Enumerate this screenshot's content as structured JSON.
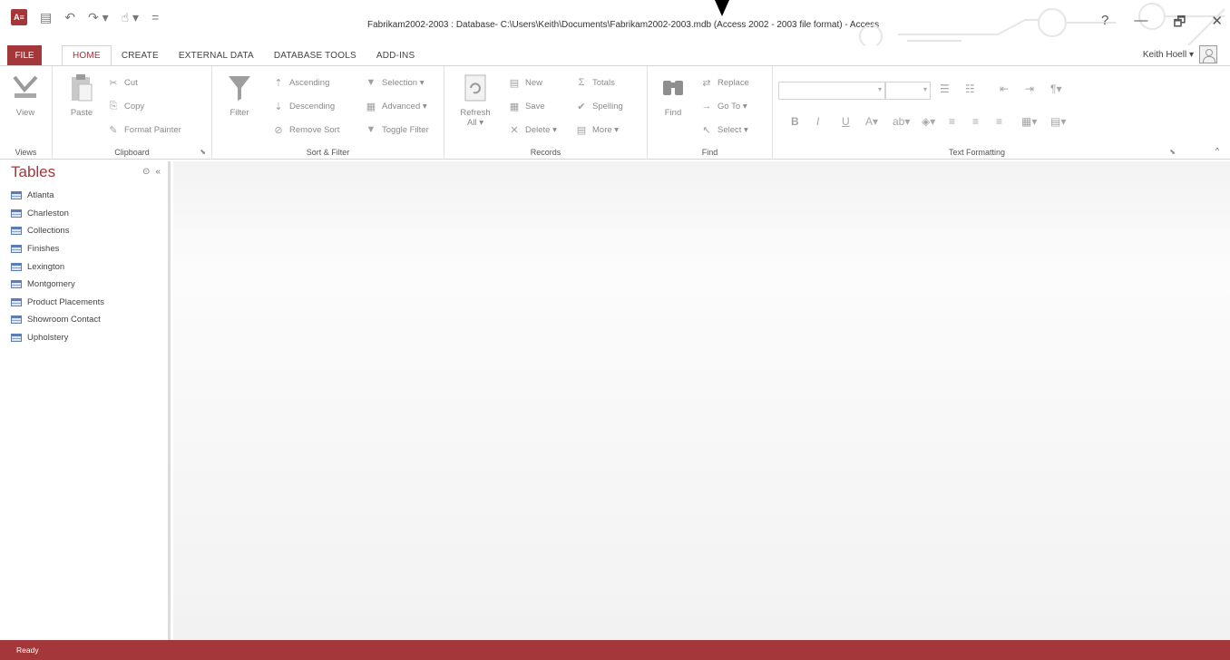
{
  "window": {
    "title": "Fabrikam2002-2003 : Database- C:\\Users\\Keith\\Documents\\Fabrikam2002-2003.mdb (Access 2002 - 2003 file format) - Access",
    "help_label": "?",
    "minimize_label": "—",
    "restore_label": "🗗",
    "close_label": "✕"
  },
  "qat": {
    "app_icon_label": "A≡",
    "save_glyph": "▤",
    "undo_glyph": "↶",
    "redo_glyph": "↷ ▾",
    "touch_glyph": "☝ ▾",
    "customize_glyph": "="
  },
  "tabs": {
    "file": "FILE",
    "items": [
      "HOME",
      "CREATE",
      "EXTERNAL DATA",
      "DATABASE TOOLS",
      "ADD-INS"
    ],
    "active": "HOME"
  },
  "user": {
    "name": "Keith Hoell ▾"
  },
  "ribbon": {
    "views": {
      "label": "Views",
      "view_button": "View"
    },
    "clipboard": {
      "label": "Clipboard",
      "paste": "Paste",
      "cut": "Cut",
      "copy": "Copy",
      "format_painter": "Format Painter"
    },
    "sort_filter": {
      "label": "Sort & Filter",
      "filter": "Filter",
      "ascending": "Ascending",
      "descending": "Descending",
      "remove_sort": "Remove Sort",
      "selection": "Selection ▾",
      "advanced": "Advanced ▾",
      "toggle_filter": "Toggle Filter"
    },
    "records": {
      "label": "Records",
      "refresh": "Refresh",
      "refresh_all": "All ▾",
      "new": "New",
      "save": "Save",
      "delete": "Delete ▾",
      "totals": "Totals",
      "spelling": "Spelling",
      "more": "More ▾"
    },
    "find": {
      "label": "Find",
      "find": "Find",
      "replace": "Replace",
      "go_to": "Go To ▾",
      "select": "Select ▾"
    },
    "text_formatting": {
      "label": "Text Formatting",
      "bold": "B",
      "italic": "I",
      "underline": "U"
    }
  },
  "nav": {
    "header": "Tables",
    "tables": [
      "Atlanta",
      "Charleston",
      "Collections",
      "Finishes",
      "Lexington",
      "Montgomery",
      "Product Placements",
      "Showroom Contact",
      "Upholstery"
    ]
  },
  "status": {
    "text": "Ready"
  },
  "colors": {
    "accent": "#a4373a",
    "ribbon_border": "#d4d4d4",
    "workspace": "#f3f3f3"
  }
}
